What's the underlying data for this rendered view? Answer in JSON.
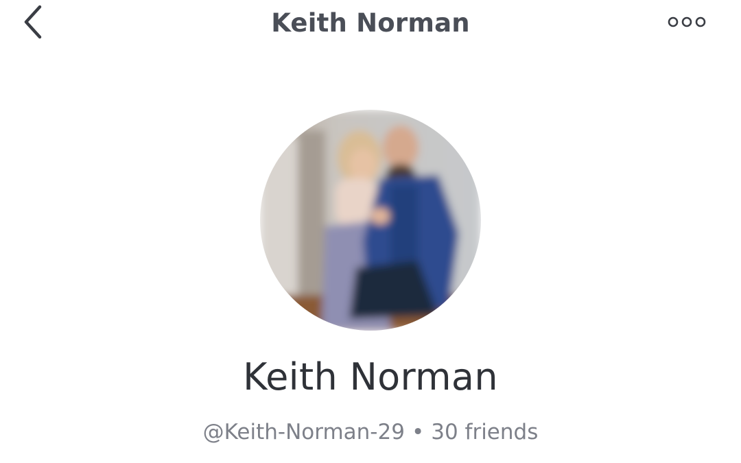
{
  "header": {
    "title": "Keith Norman",
    "back_icon": "chevron-left-icon",
    "more_icon": "more-horizontal-icon"
  },
  "profile": {
    "display_name": "Keith Norman",
    "username": "@Keith-Norman-29",
    "separator": "•",
    "friends": "30 friends"
  },
  "colors": {
    "title_text": "#4a4e57",
    "name_text": "#2f3238",
    "meta_text": "#7d8089",
    "icon": "#3a3d44"
  }
}
